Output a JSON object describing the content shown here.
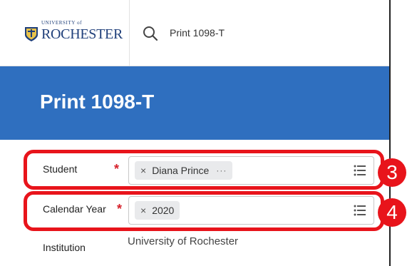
{
  "header": {
    "logo_small": "UNIVERSITY of",
    "logo_main": "ROCHESTER",
    "search_text": "Print 1098-T"
  },
  "page": {
    "title": "Print 1098-T"
  },
  "form": {
    "student": {
      "label": "Student",
      "required_mark": "*",
      "chip_remove": "×",
      "chip_value": "Diana Prince",
      "chip_more": "···"
    },
    "calendar_year": {
      "label": "Calendar Year",
      "required_mark": "*",
      "chip_remove": "×",
      "chip_value": "2020"
    },
    "institution": {
      "label": "Institution",
      "value": "University of Rochester"
    }
  },
  "annotations": {
    "step_3": "3",
    "step_4": "4"
  },
  "colors": {
    "banner": "#2f6fbf",
    "highlight": "#e8141b",
    "required": "#d6202a",
    "brand_text": "#1f3f7a"
  }
}
